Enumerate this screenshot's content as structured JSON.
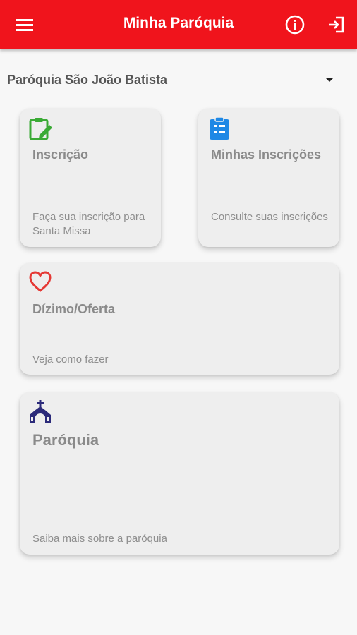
{
  "app_bar": {
    "title": "Minha Paróquia",
    "menu_icon": "menu-icon",
    "info_icon": "info-icon",
    "logout_icon": "logout-icon",
    "color": "#f0141c"
  },
  "parish_selector": {
    "selected": "Paróquia São João Batista"
  },
  "cards": {
    "inscricao": {
      "title": "Inscrição",
      "description": "Faça sua inscrição para Santa Missa",
      "icon": "clipboard-edit-icon",
      "icon_color": "#3aaa35"
    },
    "minhas_inscricoes": {
      "title": "Minhas Inscrições",
      "description": "Consulte suas inscrições",
      "icon": "clipboard-list-icon",
      "icon_color": "#1e88e5"
    },
    "dizimo": {
      "title": "Dízimo/Oferta",
      "description": "Veja como fazer",
      "icon": "heart-icon",
      "icon_color": "#e53935"
    },
    "paroquia": {
      "title": "Paróquia",
      "description": "Saiba mais sobre a paróquia",
      "icon": "church-icon",
      "icon_color": "#2b2a7a"
    }
  }
}
